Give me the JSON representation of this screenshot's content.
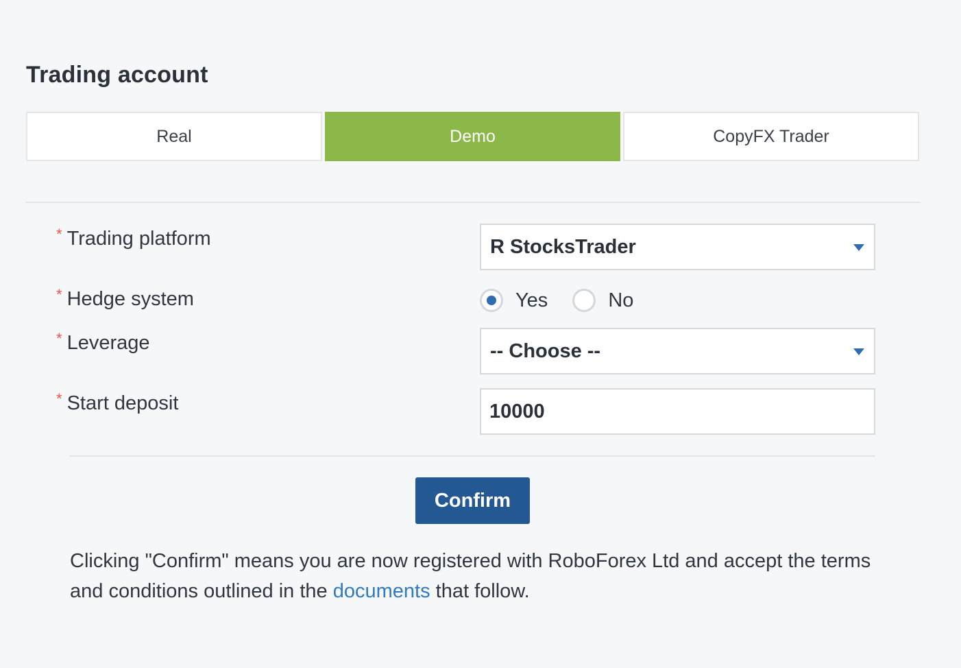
{
  "page": {
    "title": "Trading account"
  },
  "tabs": [
    {
      "label": "Real",
      "active": false
    },
    {
      "label": "Demo",
      "active": true
    },
    {
      "label": "CopyFX Trader",
      "active": false
    }
  ],
  "form": {
    "required_marker": "*",
    "trading_platform": {
      "label": "Trading platform",
      "value": "R StocksTrader"
    },
    "hedge_system": {
      "label": "Hedge system",
      "options": [
        "Yes",
        "No"
      ],
      "selected": "Yes"
    },
    "leverage": {
      "label": "Leverage",
      "value": "-- Choose --"
    },
    "start_deposit": {
      "label": "Start deposit",
      "value": "10000"
    }
  },
  "confirm": {
    "label": "Confirm"
  },
  "disclaimer": {
    "text_before": "Clicking \"Confirm\" means you are now registered with RoboForex Ltd and accept the terms and conditions outlined in the ",
    "link_text": "documents",
    "text_after": " that follow."
  },
  "colors": {
    "active_tab": "#8cb84a",
    "primary_button": "#245893",
    "link": "#2f7ac0",
    "required": "#e2574c",
    "radio_checked": "#2f6db0"
  }
}
